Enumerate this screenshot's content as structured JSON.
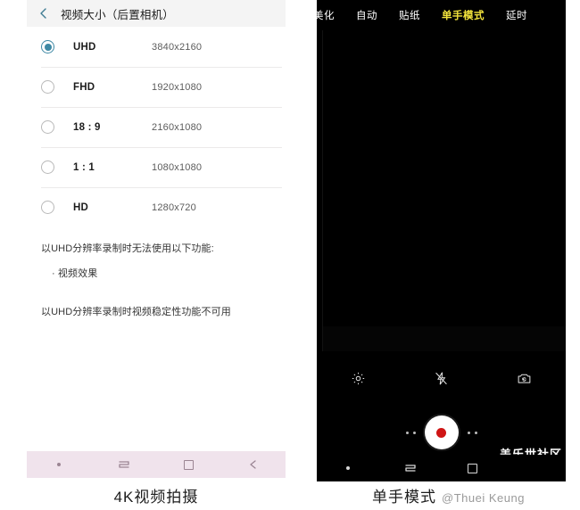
{
  "settings": {
    "header": {
      "back_icon": "back-chevron-icon",
      "title": "视频大小（后置相机）"
    },
    "options": [
      {
        "label": "UHD",
        "value": "3840x2160",
        "selected": true
      },
      {
        "label": "FHD",
        "value": "1920x1080",
        "selected": false
      },
      {
        "label": "18 : 9",
        "value": "2160x1080",
        "selected": false
      },
      {
        "label": "1 : 1",
        "value": "1080x1080",
        "selected": false
      },
      {
        "label": "HD",
        "value": "1280x720",
        "selected": false
      }
    ],
    "notes": {
      "line1": "以UHD分辨率录制时无法使用以下功能:",
      "bullet1": "· 视频效果",
      "line2": "以UHD分辨率录制时视频稳定性功能不可用"
    },
    "navbar": {
      "dot": "nav-dot-icon",
      "recents": "recents-icon",
      "home": "home-square-icon",
      "back": "back-arrow-icon"
    },
    "caption": "4K视频拍摄"
  },
  "camera": {
    "modes": [
      {
        "label": "美化",
        "active": false
      },
      {
        "label": "自动",
        "active": false
      },
      {
        "label": "贴纸",
        "active": false
      },
      {
        "label": "单手模式",
        "active": true
      },
      {
        "label": "延时",
        "active": false
      }
    ],
    "controls": {
      "settings_icon": "gear-icon",
      "flash_icon": "flash-off-icon",
      "switch_icon": "camera-switch-icon"
    },
    "shutter": {
      "name": "record-shutter-button",
      "record_color": "#cf1515"
    },
    "navbar": {
      "dot": "nav-dot-icon",
      "recents": "recents-icon",
      "home": "home-square-icon"
    },
    "watermark": "盖乐世社区",
    "caption": "单手模式",
    "attribution": "@Thuei Keung"
  },
  "colors": {
    "accent": "#3f89a5",
    "active_mode": "#f2e33c",
    "navbar_left_bg": "#f0e3ec",
    "record": "#cf1515"
  }
}
